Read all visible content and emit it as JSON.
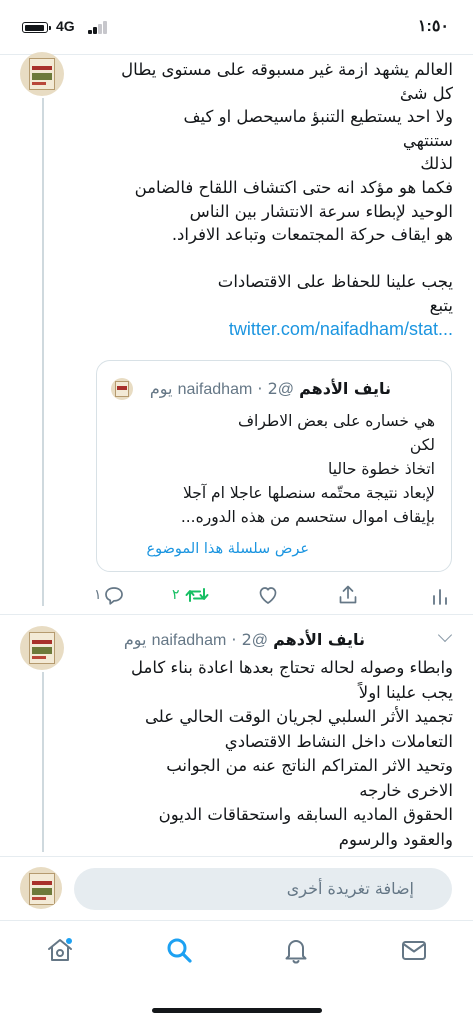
{
  "status_bar": {
    "network": "4G",
    "time": "١:٥٠"
  },
  "tweet_1": {
    "lines": [
      "العالم يشهد ازمة غير مسبوقه على مستوى يطال",
      "كل شئ",
      "ولا احد يستطيع التنبؤ ماسيحصل او كيف",
      "ستنتهي",
      "لذلك",
      "فكما هو مؤكد انه حتى اكتشاف اللقاح فالضامن",
      "الوحيد لإبطاء سرعة الانتشار بين الناس",
      "هو ايقاف حركة المجتمعات وتباعد الافراد.",
      "",
      "يجب علينا للحفاظ على الاقتصادات",
      "يتبع"
    ],
    "link": "twitter.com/naifadham/stat...",
    "quote": {
      "name": "نايف الأدهم",
      "handle": "@naifadham",
      "time": "2 يوم",
      "lines": [
        "هي خساره على بعض الاطراف",
        "لكن",
        "اتخاذ خطوة حاليا",
        "لإبعاد نتيجة محتّمه سنصلها عاجلا ام آجلا",
        "بإيقاف اموال ستحسم من هذه الدوره..."
      ],
      "show_thread": "عرض سلسلة هذا الموضوع"
    },
    "actions": {
      "reply_count": "١",
      "retweet_count": "٢"
    }
  },
  "tweet_2": {
    "name": "نايف الأدهم",
    "handle": "@naifadham",
    "time": "2 يوم",
    "lines": [
      "وابطاء وصوله لحاله تحتاج بعدها اعادة بناء كامل",
      "يجب علينا اولاً",
      "تجميد الأثر السلبي لجريان الوقت الحالي على",
      "التعاملات داخل النشاط الاقتصادي",
      "وتحيد الاثر المتراكم الناتج عنه من الجوانب",
      "الاخرى خارجه",
      "الحقوق الماديه السابقه واستحقاقات الديون",
      "والعقود والرسوم"
    ]
  },
  "reply_bar": {
    "placeholder": "إضافة تغريدة أخرى"
  },
  "tabs": [
    "home-icon",
    "search-icon",
    "notifications-icon",
    "messages-icon"
  ],
  "colors": {
    "accent": "#1da1f2",
    "link": "#1b95e0",
    "retweet": "#17bf63",
    "secondary": "#657786"
  }
}
